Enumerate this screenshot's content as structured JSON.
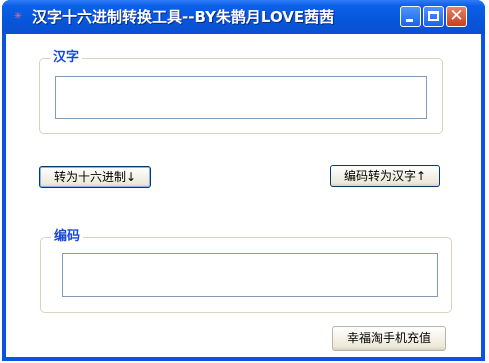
{
  "window": {
    "title": "汉字十六进制转换工具--BY朱鹊月LOVE茜茜",
    "icon": "app-icon",
    "controls": [
      "minimize-icon",
      "maximize-icon",
      "close-icon"
    ]
  },
  "hanzi_group": {
    "label": "汉字",
    "input_value": ""
  },
  "buttons": {
    "to_hex": "转为十六进制↓",
    "to_hanzi": "编码转为汉字↑",
    "recharge": "幸福淘手机充值"
  },
  "code_group": {
    "label": "编码",
    "input_value": ""
  },
  "colors": {
    "title_bar": "#0756db",
    "group_label": "#1a49d6",
    "close_button": "#c8401e"
  }
}
